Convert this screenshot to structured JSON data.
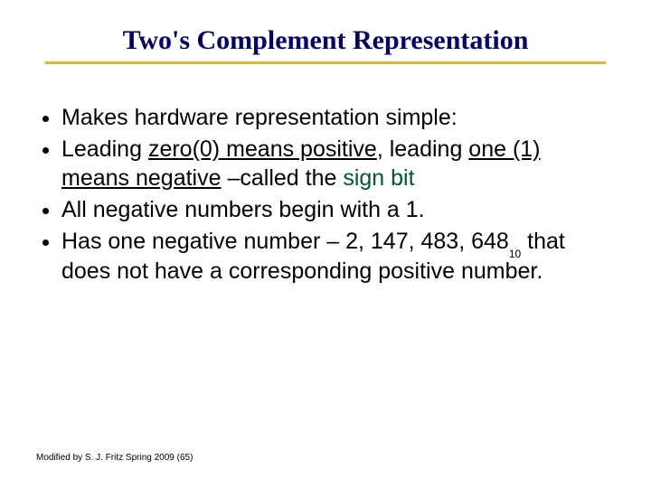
{
  "title": "Two's Complement Representation",
  "bullets": {
    "b1": "Makes hardware representation simple:",
    "b2": {
      "pre": "Leading ",
      "u1": "zero(0) means positive",
      "mid": ", leading ",
      "u2": "one (1) means negative",
      "post": " –called the ",
      "green": "sign bit"
    },
    "b3": "All negative numbers begin with a 1.",
    "b4": {
      "pre": "Has one negative number – 2, 147, 483, 648",
      "sub": "10",
      "post": " that does not have a corresponding positive number."
    }
  },
  "footer": "Modified by S. J. Fritz  Spring 2009 (65)"
}
